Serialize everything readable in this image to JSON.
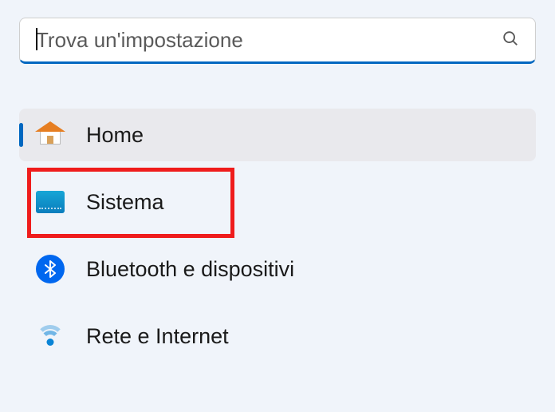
{
  "search": {
    "placeholder": "Trova un'impostazione"
  },
  "nav": {
    "items": [
      {
        "label": "Home"
      },
      {
        "label": "Sistema"
      },
      {
        "label": "Bluetooth e dispositivi"
      },
      {
        "label": "Rete e Internet"
      }
    ]
  }
}
